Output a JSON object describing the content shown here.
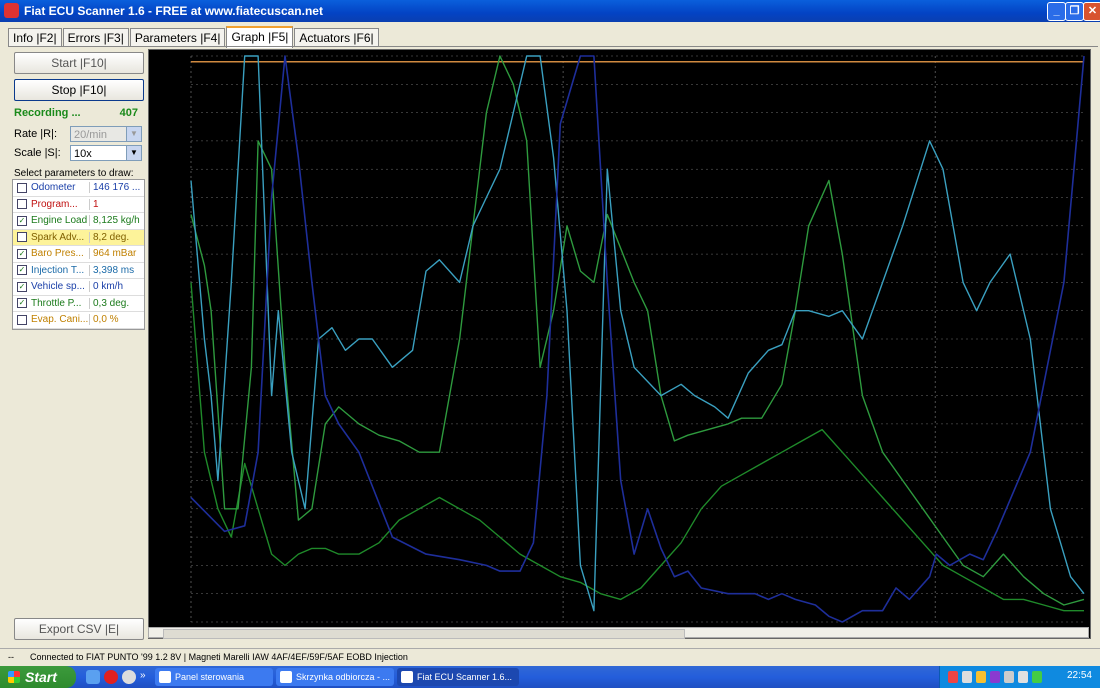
{
  "window": {
    "title": "Fiat ECU Scanner 1.6 - FREE at www.fiatecuscan.net",
    "minimize": "_",
    "maximize": "❐",
    "close": "✕"
  },
  "tabs": [
    {
      "label": "Info |F2|"
    },
    {
      "label": "Errors |F3|"
    },
    {
      "label": "Parameters |F4|"
    },
    {
      "label": "Graph |F5|"
    },
    {
      "label": "Actuators |F6|"
    }
  ],
  "controls": {
    "start_label": "Start |F10|",
    "stop_label": "Stop |F10|",
    "recording_label": "Recording ...",
    "recording_count": "407",
    "rate_label": "Rate |R|:",
    "rate_value": "20/min",
    "scale_label": "Scale |S|:",
    "scale_value": "10x",
    "select_params_label": "Select parameters to draw:",
    "export_label": "Export CSV |E|"
  },
  "params": [
    {
      "name": "Odometer",
      "value": "146 176 ...",
      "checked": false,
      "color": "#1a3fa8",
      "bg": "#ffffff"
    },
    {
      "name": "Program...",
      "value": "1",
      "checked": false,
      "color": "#c01010",
      "bg": "#ffffff"
    },
    {
      "name": "Engine Load",
      "value": "8,125 kg/h",
      "checked": true,
      "color": "#1a7a1a",
      "bg": "#ffffff"
    },
    {
      "name": "Spark Adv...",
      "value": "8,2 deg.",
      "checked": false,
      "color": "#806000",
      "bg": "#fdf39a"
    },
    {
      "name": "Baro Pres...",
      "value": "964 mBar",
      "checked": true,
      "color": "#c08000",
      "bg": "#ffffff"
    },
    {
      "name": "Injection T...",
      "value": "3,398 ms",
      "checked": true,
      "color": "#1a6aa8",
      "bg": "#ffffff"
    },
    {
      "name": "Vehicle sp...",
      "value": "0 km/h",
      "checked": true,
      "color": "#1a3fa8",
      "bg": "#ffffff"
    },
    {
      "name": "Throttle P...",
      "value": "0,3 deg.",
      "checked": true,
      "color": "#1a7a1a",
      "bg": "#ffffff"
    },
    {
      "name": "Evap. Cani...",
      "value": "0,0 %",
      "checked": false,
      "color": "#c08000",
      "bg": "#ffffff"
    }
  ],
  "status": {
    "left": "--",
    "text": "Connected to FIAT PUNTO '99 1.2 8V | Magneti Marelli IAW 4AF/4EF/59F/5AF EOBD Injection"
  },
  "taskbar": {
    "start_label": "Start",
    "tasks": [
      {
        "label": "Panel sterowania"
      },
      {
        "label": "Skrzynka odbiorcza - ..."
      },
      {
        "label": "Fiat ECU Scanner 1.6..."
      }
    ],
    "clock": "22:54"
  },
  "graph": {
    "colors": {
      "vehicle_speed": "#1e2e9a",
      "injection": "#3aa0c0",
      "engine_load": "#2e9a3e",
      "throttle": "#1f8a2a",
      "baro": "#d08a40",
      "grid": "#bbbbbb"
    },
    "series": {
      "vehicle_speed": [
        [
          0,
          22
        ],
        [
          5,
          16
        ],
        [
          8,
          17
        ],
        [
          10,
          30
        ],
        [
          12,
          75
        ],
        [
          14,
          100
        ],
        [
          16,
          82
        ],
        [
          18,
          60
        ],
        [
          20,
          40
        ],
        [
          22,
          35
        ],
        [
          25,
          30
        ],
        [
          30,
          15
        ],
        [
          35,
          12
        ],
        [
          40,
          11
        ],
        [
          44,
          10
        ],
        [
          46,
          9
        ],
        [
          49,
          9
        ],
        [
          51,
          14
        ],
        [
          53,
          40
        ],
        [
          55,
          88
        ],
        [
          58,
          100
        ],
        [
          60,
          100
        ],
        [
          62,
          60
        ],
        [
          64,
          25
        ],
        [
          66,
          12
        ],
        [
          68,
          20
        ],
        [
          70,
          13
        ],
        [
          72,
          8
        ],
        [
          74,
          9
        ],
        [
          76,
          6
        ],
        [
          80,
          5
        ],
        [
          84,
          5
        ],
        [
          86,
          4
        ],
        [
          88,
          5
        ],
        [
          90,
          4
        ],
        [
          93,
          3
        ],
        [
          95,
          1
        ],
        [
          97,
          0
        ],
        [
          100,
          2
        ],
        [
          103,
          2
        ],
        [
          105,
          6
        ],
        [
          107,
          4
        ],
        [
          110,
          8
        ],
        [
          111,
          12
        ],
        [
          113,
          10
        ],
        [
          116,
          12
        ],
        [
          118,
          11
        ],
        [
          120,
          16
        ],
        [
          125,
          30
        ],
        [
          130,
          60
        ],
        [
          133,
          100
        ]
      ],
      "injection": [
        [
          0,
          78
        ],
        [
          2,
          50
        ],
        [
          3,
          40
        ],
        [
          4,
          25
        ],
        [
          6,
          60
        ],
        [
          8,
          100
        ],
        [
          10,
          100
        ],
        [
          11,
          70
        ],
        [
          12,
          40
        ],
        [
          13,
          55
        ],
        [
          15,
          30
        ],
        [
          17,
          20
        ],
        [
          19,
          50
        ],
        [
          21,
          52
        ],
        [
          23,
          48
        ],
        [
          25,
          50
        ],
        [
          27,
          50
        ],
        [
          30,
          45
        ],
        [
          33,
          48
        ],
        [
          35,
          62
        ],
        [
          37,
          64
        ],
        [
          40,
          60
        ],
        [
          42,
          70
        ],
        [
          44,
          75
        ],
        [
          46,
          80
        ],
        [
          48,
          90
        ],
        [
          50,
          100
        ],
        [
          52,
          100
        ],
        [
          54,
          82
        ],
        [
          56,
          55
        ],
        [
          58,
          10
        ],
        [
          60,
          2
        ],
        [
          62,
          80
        ],
        [
          64,
          55
        ],
        [
          66,
          45
        ],
        [
          70,
          40
        ],
        [
          73,
          42
        ],
        [
          75,
          40
        ],
        [
          78,
          38
        ],
        [
          80,
          36
        ],
        [
          83,
          44
        ],
        [
          86,
          48
        ],
        [
          88,
          49
        ],
        [
          90,
          55
        ],
        [
          92,
          55
        ],
        [
          95,
          54
        ],
        [
          97,
          55
        ],
        [
          100,
          50
        ],
        [
          103,
          60
        ],
        [
          106,
          70
        ],
        [
          110,
          85
        ],
        [
          112,
          80
        ],
        [
          115,
          60
        ],
        [
          117,
          55
        ],
        [
          119,
          60
        ],
        [
          122,
          65
        ],
        [
          125,
          50
        ],
        [
          128,
          20
        ],
        [
          131,
          8
        ],
        [
          133,
          5
        ]
      ],
      "engine_load": [
        [
          0,
          72
        ],
        [
          2,
          63
        ],
        [
          3,
          55
        ],
        [
          5,
          20
        ],
        [
          7,
          20
        ],
        [
          9,
          45
        ],
        [
          10,
          85
        ],
        [
          12,
          80
        ],
        [
          14,
          45
        ],
        [
          16,
          18
        ],
        [
          18,
          20
        ],
        [
          20,
          35
        ],
        [
          22,
          38
        ],
        [
          25,
          35
        ],
        [
          28,
          33
        ],
        [
          31,
          32
        ],
        [
          34,
          30
        ],
        [
          37,
          30
        ],
        [
          40,
          50
        ],
        [
          42,
          70
        ],
        [
          44,
          90
        ],
        [
          46,
          100
        ],
        [
          48,
          95
        ],
        [
          50,
          85
        ],
        [
          52,
          45
        ],
        [
          54,
          55
        ],
        [
          56,
          70
        ],
        [
          58,
          62
        ],
        [
          60,
          60
        ],
        [
          62,
          72
        ],
        [
          64,
          66
        ],
        [
          66,
          60
        ],
        [
          68,
          55
        ],
        [
          70,
          40
        ],
        [
          72,
          32
        ],
        [
          74,
          33
        ],
        [
          77,
          34
        ],
        [
          80,
          35
        ],
        [
          82,
          36
        ],
        [
          85,
          36
        ],
        [
          88,
          42
        ],
        [
          90,
          55
        ],
        [
          92,
          70
        ],
        [
          95,
          78
        ],
        [
          97,
          65
        ],
        [
          100,
          40
        ],
        [
          103,
          30
        ],
        [
          106,
          25
        ],
        [
          109,
          20
        ],
        [
          112,
          15
        ],
        [
          115,
          10
        ],
        [
          118,
          8
        ],
        [
          121,
          12
        ],
        [
          124,
          8
        ],
        [
          127,
          5
        ],
        [
          130,
          3
        ],
        [
          133,
          4
        ]
      ],
      "throttle": [
        [
          0,
          60
        ],
        [
          2,
          30
        ],
        [
          4,
          20
        ],
        [
          6,
          15
        ],
        [
          8,
          28
        ],
        [
          10,
          20
        ],
        [
          12,
          12
        ],
        [
          14,
          10
        ],
        [
          16,
          12
        ],
        [
          18,
          13
        ],
        [
          20,
          13
        ],
        [
          22,
          12
        ],
        [
          25,
          12
        ],
        [
          28,
          14
        ],
        [
          31,
          18
        ],
        [
          34,
          20
        ],
        [
          37,
          22
        ],
        [
          40,
          20
        ],
        [
          43,
          18
        ],
        [
          46,
          15
        ],
        [
          49,
          12
        ],
        [
          52,
          10
        ],
        [
          55,
          8
        ],
        [
          58,
          7
        ],
        [
          61,
          5
        ],
        [
          64,
          4
        ],
        [
          67,
          6
        ],
        [
          70,
          10
        ],
        [
          73,
          14
        ],
        [
          76,
          20
        ],
        [
          79,
          24
        ],
        [
          82,
          26
        ],
        [
          85,
          28
        ],
        [
          88,
          30
        ],
        [
          91,
          32
        ],
        [
          94,
          34
        ],
        [
          97,
          30
        ],
        [
          100,
          26
        ],
        [
          103,
          22
        ],
        [
          106,
          18
        ],
        [
          109,
          14
        ],
        [
          112,
          10
        ],
        [
          115,
          8
        ],
        [
          118,
          6
        ],
        [
          121,
          4
        ],
        [
          124,
          4
        ],
        [
          127,
          3
        ],
        [
          130,
          2
        ],
        [
          133,
          2
        ]
      ],
      "baro": [
        [
          0,
          99
        ],
        [
          133,
          99
        ]
      ]
    }
  }
}
